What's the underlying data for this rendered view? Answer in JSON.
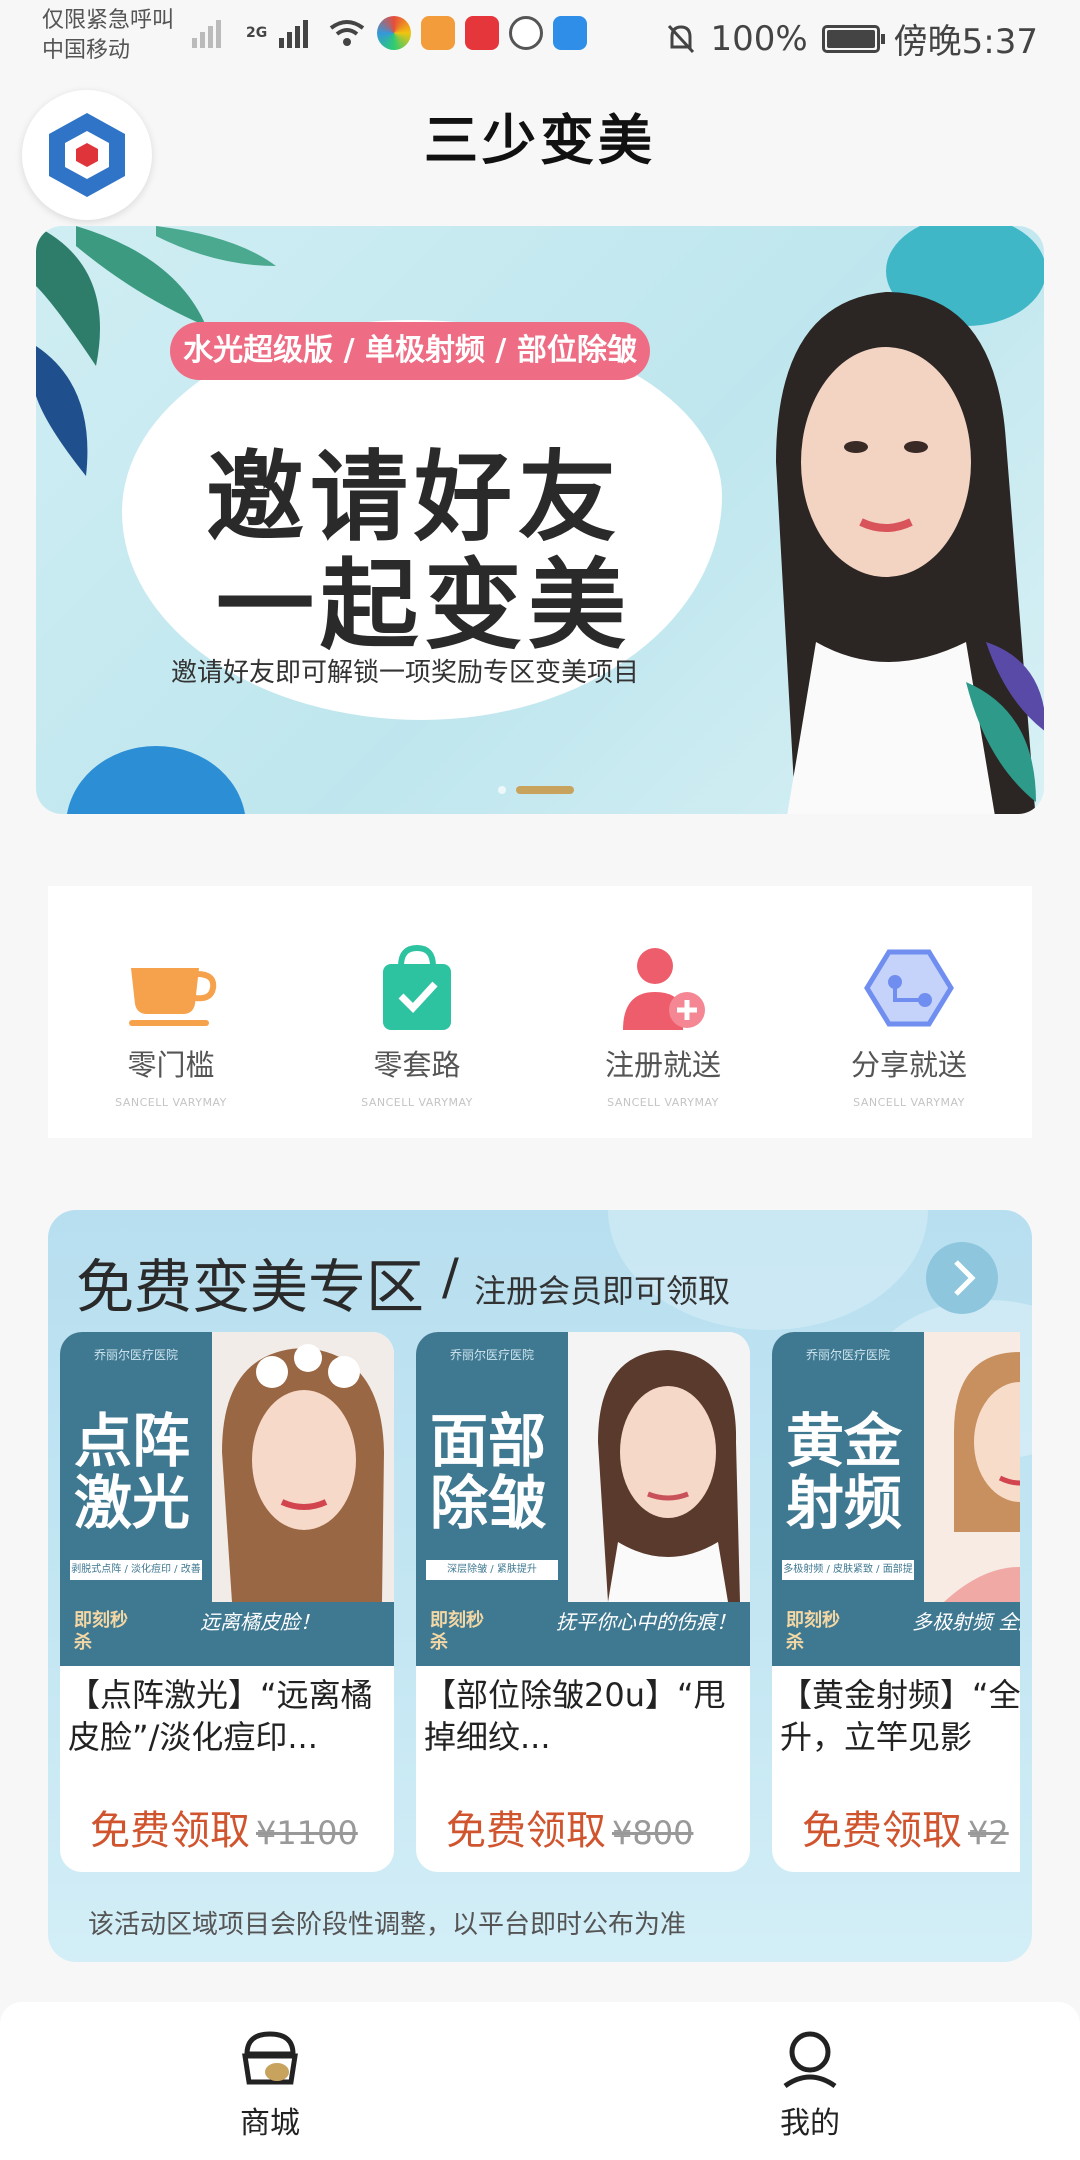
{
  "status_bar": {
    "line1": "仅限紧急呼叫",
    "line2": "中国移动",
    "network": "2G",
    "battery": "100%",
    "battery_level": 1.0,
    "time": "傍晚5:37"
  },
  "header": {
    "title": "三少变美"
  },
  "banner": {
    "tagline": "水光超级版 / 单极射频 / 部位除皱",
    "headline_line1": "邀请好友",
    "headline_line2": "一起变美",
    "subtitle": "邀请好友即可解锁一项奖励专区变美项目",
    "page_count": 2,
    "active_page": 2
  },
  "features": [
    {
      "label": "零门槛",
      "en": "SANCELL VARYMAY",
      "icon": "cup-icon",
      "color": "#f6a14b"
    },
    {
      "label": "零套路",
      "en": "SANCELL VARYMAY",
      "icon": "shopping-bag-check-icon",
      "color": "#2ec3a0"
    },
    {
      "label": "注册就送",
      "en": "SANCELL VARYMAY",
      "icon": "add-user-icon",
      "color": "#ee5d6b"
    },
    {
      "label": "分享就送",
      "en": "SANCELL VARYMAY",
      "icon": "share-icon",
      "color": "#6f8ef0"
    }
  ],
  "free_zone": {
    "title": "免费变美专区",
    "slash": "/",
    "subtitle": "注册会员即可领取",
    "note": "该活动区域项目会阶段性调整，以平台即时公布为准",
    "cards": [
      {
        "brand": "乔丽尔医疗医院",
        "big_text": "点阵激光",
        "strip": "剥脱式点阵 / 淡化痘印 / 改善毛孔",
        "flash": "即刻秒杀",
        "script": "远离橘皮脸！",
        "name": "【点阵激光】“远离橘皮脸”/淡化痘印...",
        "price": "免费领取",
        "original_price": "¥1100"
      },
      {
        "brand": "乔丽尔医疗医院",
        "big_text": "面部除皱",
        "strip": "深层除皱 / 紧肤提升",
        "flash": "即刻秒杀",
        "script": "抚平你心中的伤痕！",
        "name": "【部位除皱20u】“甩掉细纹...",
        "price": "免费领取",
        "original_price": "¥800"
      },
      {
        "brand": "乔丽尔医疗医院",
        "big_text": "黄金射频",
        "strip": "多极射频 / 皮肤紧致 / 面部提升",
        "flash": "即刻秒杀",
        "script": "多极射频 全脸提升",
        "name": "【黄金射频】“全脸提升，立竿见影",
        "price": "免费领取",
        "original_price": "¥2"
      }
    ]
  },
  "bottom_nav": [
    {
      "label": "商城",
      "icon": "shop-icon",
      "active": true
    },
    {
      "label": "我的",
      "icon": "user-icon",
      "active": false
    }
  ],
  "colors": {
    "price": "#d0552f",
    "card_panel": "#3f7891",
    "tag_pink": "#ee6d84",
    "zone_bg": "#b8dff0"
  }
}
